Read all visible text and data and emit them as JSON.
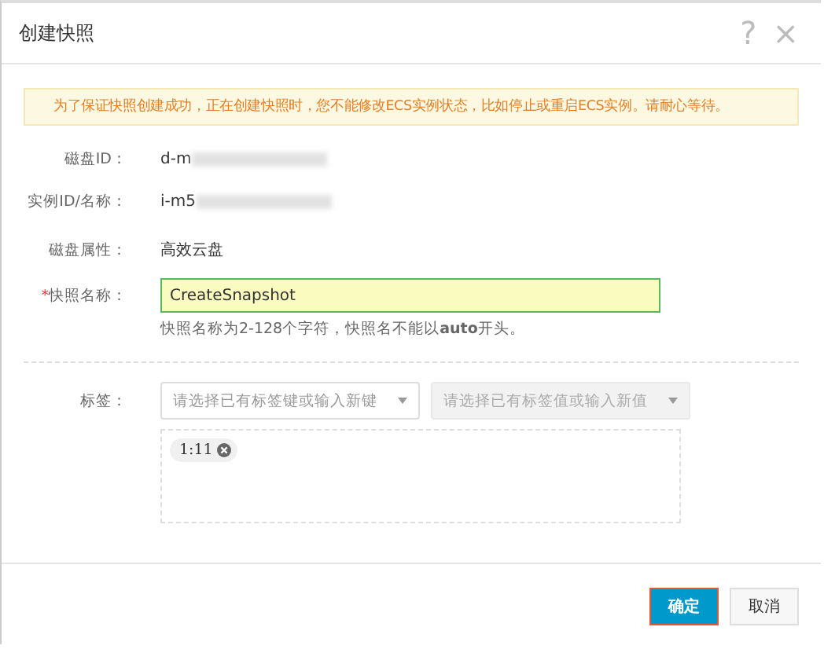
{
  "dialog": {
    "title": "创建快照",
    "help": "?",
    "close": "×"
  },
  "notice": "为了保证快照创建成功，正在创建快照时，您不能修改ECS实例状态，比如停止或重启ECS实例。请耐心等待。",
  "fields": [
    {
      "kind": "text",
      "label": "磁盘ID：",
      "value": "d-m",
      "redacted": true
    },
    {
      "kind": "text",
      "label": "实例ID/名称：",
      "value": "i-m5",
      "redacted": true
    },
    {
      "kind": "text",
      "label": "磁盘属性：",
      "value": "高效云盘",
      "redacted": false
    },
    {
      "kind": "input",
      "label": "快照名称：",
      "required_mark": "*",
      "value": "CreateSnapshot",
      "hint": "快照名称为2-128个字符，快照名不能以**auto**开头。"
    }
  ],
  "tags": {
    "label": "标签：",
    "key_select": {
      "placeholder": "请选择已有标签键或输入新键",
      "disabled": false
    },
    "value_select": {
      "placeholder": "请选择已有标签值或输入新值",
      "disabled": true
    },
    "chips": [
      "1:11"
    ]
  },
  "buttons": [
    {
      "label": "确定",
      "kind": "primary"
    },
    {
      "label": "取消",
      "kind": "default"
    }
  ]
}
